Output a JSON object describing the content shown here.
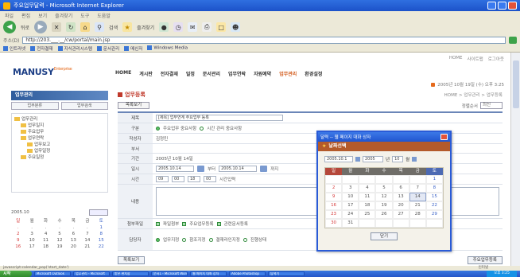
{
  "window": {
    "title": "주요업무달력 - Microsoft Internet Explorer"
  },
  "menu": [
    "파일",
    "편집",
    "보기",
    "즐겨찾기",
    "도구",
    "도움말"
  ],
  "toolbar": {
    "back_label": "뒤로",
    "search_label": "검색",
    "favorites_label": "즐겨찾기"
  },
  "address": {
    "label": "주소(D)",
    "value": "http://203.___.__/cw/portal/main.jsp"
  },
  "links": [
    "인트라넷",
    "전자결재",
    "지식관리시스템",
    "문서관리",
    "메신저",
    "Windows Media"
  ],
  "site": {
    "util_links": [
      "HOME",
      "사이트맵",
      "로그아웃"
    ],
    "logo": "MANUSY",
    "logo_sup": "Enterprise",
    "gnb": [
      "HOME",
      "게시판",
      "전자결재",
      "일정",
      "문서관리",
      "업무연락",
      "자원예약",
      "업무관리",
      "환경설정"
    ],
    "gnb_active_index": 7,
    "date_line": "2005년 10월 19일 (수) 오후 3:25"
  },
  "lnb": {
    "title": "업무관리",
    "tabs": [
      "업무분류",
      "업무검색"
    ],
    "tree": [
      "업무관리",
      "업무일지",
      "주요업무",
      "업무연락",
      "업무보고",
      "업무일정",
      "주요일정"
    ]
  },
  "mini_cal": {
    "month": "2005.10",
    "weekdays": [
      "일",
      "월",
      "화",
      "수",
      "목",
      "금",
      "토"
    ],
    "days": [
      "",
      "",
      "",
      "",
      "",
      "",
      "1",
      "2",
      "3",
      "4",
      "5",
      "6",
      "7",
      "8",
      "9",
      "10",
      "11",
      "12",
      "13",
      "14",
      "15",
      "16",
      "17",
      "18",
      "19",
      "20",
      "21",
      "22"
    ]
  },
  "main": {
    "title": "업무등록",
    "breadcrumb": "HOME > 업무관리 > 업무등록",
    "list_button": "목록보기",
    "sort_label": "정렬순서",
    "sort_value": "최신",
    "rows": [
      {
        "th": "제목",
        "value": "[제목] 업무연계 주요업무 등록"
      },
      {
        "th": "구분",
        "radio1": "주요업무 중요사항",
        "radio2": "시간 관리 중요사항"
      },
      {
        "th": "작성자",
        "value": "김정민"
      },
      {
        "th": "부서",
        "value": ""
      },
      {
        "th": "기간",
        "value": "2005년 10월 14일"
      },
      {
        "th": "일시",
        "start_date": "2005.10.14",
        "start_label": "부터",
        "end_date": "2005.10.14",
        "end_label": "까지"
      },
      {
        "th": "시간",
        "hour1": "09",
        "min1": "00",
        "hour2": "18",
        "min2": "00",
        "label": "시간입력"
      },
      {
        "th": "내용"
      },
      {
        "th": "첨부파일",
        "options": [
          "파일첨부",
          "주요업무등록",
          "관련문서등록"
        ]
      },
      {
        "th": "담당자",
        "options": [
          "업무지정",
          "참조지정",
          "결재라인지정",
          "진행상태"
        ]
      }
    ],
    "bottom_left": "목록보기",
    "bottom_right": "주요업무등록"
  },
  "popup": {
    "title": "달력 -- 웹 페이지 대화 상자",
    "heading": "날짜선택",
    "date_value": "2005.10.1",
    "year_value": "2005",
    "year_label": "년",
    "month_value": "10",
    "month_label": "월",
    "weekdays": [
      "일",
      "월",
      "화",
      "수",
      "목",
      "금",
      "토"
    ],
    "days": [
      "",
      "",
      "",
      "",
      "",
      "",
      "1",
      "2",
      "3",
      "4",
      "5",
      "6",
      "7",
      "8",
      "9",
      "10",
      "11",
      "12",
      "13",
      "14",
      "15",
      "16",
      "17",
      "18",
      "19",
      "20",
      "21",
      "22",
      "23",
      "24",
      "25",
      "26",
      "27",
      "28",
      "29",
      "30",
      "31",
      "",
      "",
      "",
      "",
      ""
    ],
    "today_index": 19,
    "close_button": "닫기"
  },
  "status": {
    "text": "javascript:calendar_pop('start_date')",
    "zone": "인터넷"
  },
  "taskbar": {
    "start": "시작",
    "tasks": [
      "Microsoft Outlook",
      "업무관리 - Microsoft",
      "받은 편지함",
      "문서1 - Microsoft Word",
      "웹 페이지 대화 상자",
      "Adobe Photoshop",
      "탐색기"
    ],
    "clock": "오후 3:25"
  },
  "colors": {
    "brand": "#1d3f86",
    "accent": "#d35a1a",
    "title_red": "#c0392b",
    "popup_head": "#b45a2a"
  },
  "icons": {
    "back": "back-arrow-icon",
    "forward": "forward-arrow-icon",
    "go": "go-arrow-icon",
    "folder": "folder-icon",
    "calendar": "calendar-icon",
    "close": "close-icon"
  }
}
